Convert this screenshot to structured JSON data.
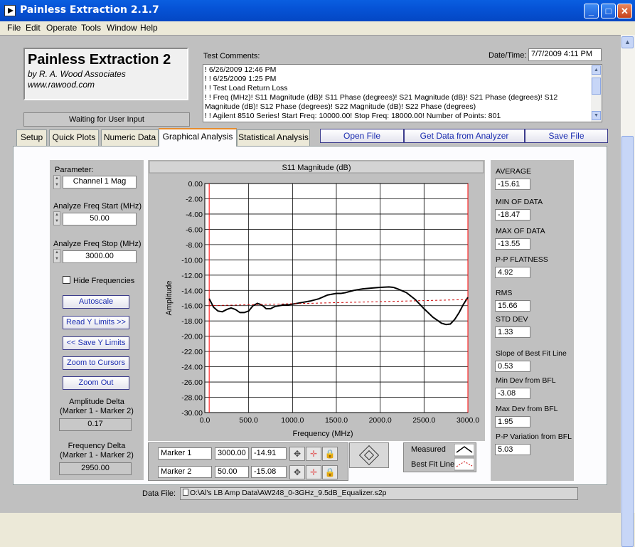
{
  "window": {
    "title": "Painless Extraction 2.1.7",
    "minimize": "_",
    "maximize": "□",
    "close": "✕"
  },
  "menu": [
    "File",
    "Edit",
    "Operate",
    "Tools",
    "Window",
    "Help"
  ],
  "logo": {
    "line1": "Painless Extraction 2",
    "line2": "by R. A. Wood Associates",
    "line3": "www.rawood.com"
  },
  "status": "Waiting for User Input",
  "comments": {
    "label": "Test Comments:",
    "lines": [
      "! 6/26/2009 12:46 PM",
      "! ! 6/25/2009 1:25 PM",
      "! ! Test Load Return Loss",
      "! ! Freq (MHz)! S11 Magnitude (dB)! S11 Phase (degrees)! S21 Magnitude (dB)! S21 Phase (degrees)! S12 Magnitude (dB)! S12 Phase (degrees)! S22 Magnitude (dB)! S22 Phase (degrees)",
      "! ! Agilent 8510 Series! Start Freq: 10000.00! Stop Freq: 18000.00! Number of Points: 801"
    ]
  },
  "datetime": {
    "label": "Date/Time:",
    "value": "7/7/2009  4:11 PM"
  },
  "tabs": [
    "Setup",
    "Quick Plots",
    "Numeric Data",
    "Graphical Analysis",
    "Statistical Analysis"
  ],
  "active_tab": "Graphical Analysis",
  "actions": {
    "open": "Open File",
    "get_data": "Get Data from Analyzer",
    "save": "Save File"
  },
  "left_panel": {
    "parameter_label": "Parameter:",
    "parameter_value": "Channel 1 Mag",
    "start_label": "Analyze Freq Start (MHz)",
    "start_value": "50.00",
    "stop_label": "Analyze Freq Stop (MHz)",
    "stop_value": "3000.00",
    "hide_freq_label": "Hide Frequencies",
    "buttons": {
      "autoscale": "Autoscale",
      "read_y": "Read Y Limits >>",
      "save_y": "<< Save Y Limits",
      "zoom_cursors": "Zoom to Cursors",
      "zoom_out": "Zoom Out"
    },
    "amp_delta_label1": "Amplitude Delta",
    "amp_delta_label2": "(Marker 1 - Marker 2)",
    "amp_delta_value": "0.17",
    "freq_delta_label1": "Frequency Delta",
    "freq_delta_label2": "(Marker 1 - Marker 2)",
    "freq_delta_value": "2950.00"
  },
  "markers": [
    {
      "name": "Marker 1",
      "freq": "3000.00",
      "value": "-14.91"
    },
    {
      "name": "Marker 2",
      "freq": "50.00",
      "value": "-15.08"
    }
  ],
  "legend": {
    "measured": "Measured",
    "bfl": "Best Fit Line"
  },
  "stats": {
    "average_label": "AVERAGE",
    "average": "-15.61",
    "min_label": "MIN OF DATA",
    "min": "-18.47",
    "max_label": "MAX OF DATA",
    "max": "-13.55",
    "pp_label": "P-P FLATNESS",
    "pp": "4.92",
    "rms_label": "RMS",
    "rms": "15.66",
    "std_label": "STD DEV",
    "std": "1.33",
    "slope_label": "Slope of Best Fit Line",
    "slope": "0.53",
    "mindev_label": "Min Dev from BFL",
    "mindev": "-3.08",
    "maxdev_label": "Max Dev from BFL",
    "maxdev": "1.95",
    "ppvar_label": "P-P Variation from BFL",
    "ppvar": "5.03"
  },
  "data_file": {
    "label": "Data File:",
    "path": "O:\\Al's LB Amp Data\\AW248_0-3GHz_9.5dB_Equalizer.s2p"
  },
  "chart_data": {
    "type": "line",
    "title": "S11 Magnitude (dB)",
    "xlabel": "Frequency (MHz)",
    "ylabel": "Amplitude",
    "xlim": [
      0,
      3000
    ],
    "ylim": [
      -30,
      0
    ],
    "x_ticks": [
      "0.0",
      "500.0",
      "1000.0",
      "1500.0",
      "2000.0",
      "2500.0",
      "3000.0"
    ],
    "y_ticks": [
      "0.00",
      "-2.00",
      "-4.00",
      "-6.00",
      "-8.00",
      "-10.00",
      "-12.00",
      "-14.00",
      "-16.00",
      "-18.00",
      "-20.00",
      "-22.00",
      "-24.00",
      "-26.00",
      "-28.00",
      "-30.00"
    ],
    "grid": true,
    "colors": {
      "background": "#ffffff",
      "grid": "#000000",
      "measured": "#000000",
      "best_fit": "#cc0000",
      "marker": "#ff0000"
    },
    "series": [
      {
        "name": "Measured",
        "x": [
          50,
          100,
          150,
          200,
          250,
          300,
          350,
          400,
          450,
          500,
          550,
          600,
          650,
          700,
          750,
          800,
          850,
          900,
          950,
          1000,
          1100,
          1200,
          1300,
          1400,
          1500,
          1550,
          1600,
          1700,
          1800,
          1900,
          2000,
          2100,
          2150,
          2200,
          2300,
          2400,
          2500,
          2600,
          2700,
          2750,
          2800,
          2850,
          2900,
          2950,
          3000
        ],
        "y": [
          -15.08,
          -16.2,
          -16.7,
          -16.8,
          -16.5,
          -16.3,
          -16.5,
          -16.9,
          -16.9,
          -16.7,
          -16.0,
          -15.7,
          -15.9,
          -16.4,
          -16.4,
          -16.1,
          -16.0,
          -15.9,
          -15.9,
          -15.8,
          -15.6,
          -15.4,
          -15.1,
          -14.6,
          -14.4,
          -14.4,
          -14.3,
          -14.0,
          -13.8,
          -13.7,
          -13.6,
          -13.55,
          -13.6,
          -13.8,
          -14.3,
          -15.2,
          -16.4,
          -17.5,
          -18.3,
          -18.47,
          -18.4,
          -17.8,
          -16.9,
          -15.8,
          -14.91
        ]
      },
      {
        "name": "Best Fit Line",
        "x": [
          50,
          3000
        ],
        "y": [
          -16.0,
          -15.2
        ]
      }
    ],
    "markers": [
      {
        "name": "Marker 1",
        "x": 3000
      },
      {
        "name": "Marker 2",
        "x": 50
      }
    ]
  }
}
